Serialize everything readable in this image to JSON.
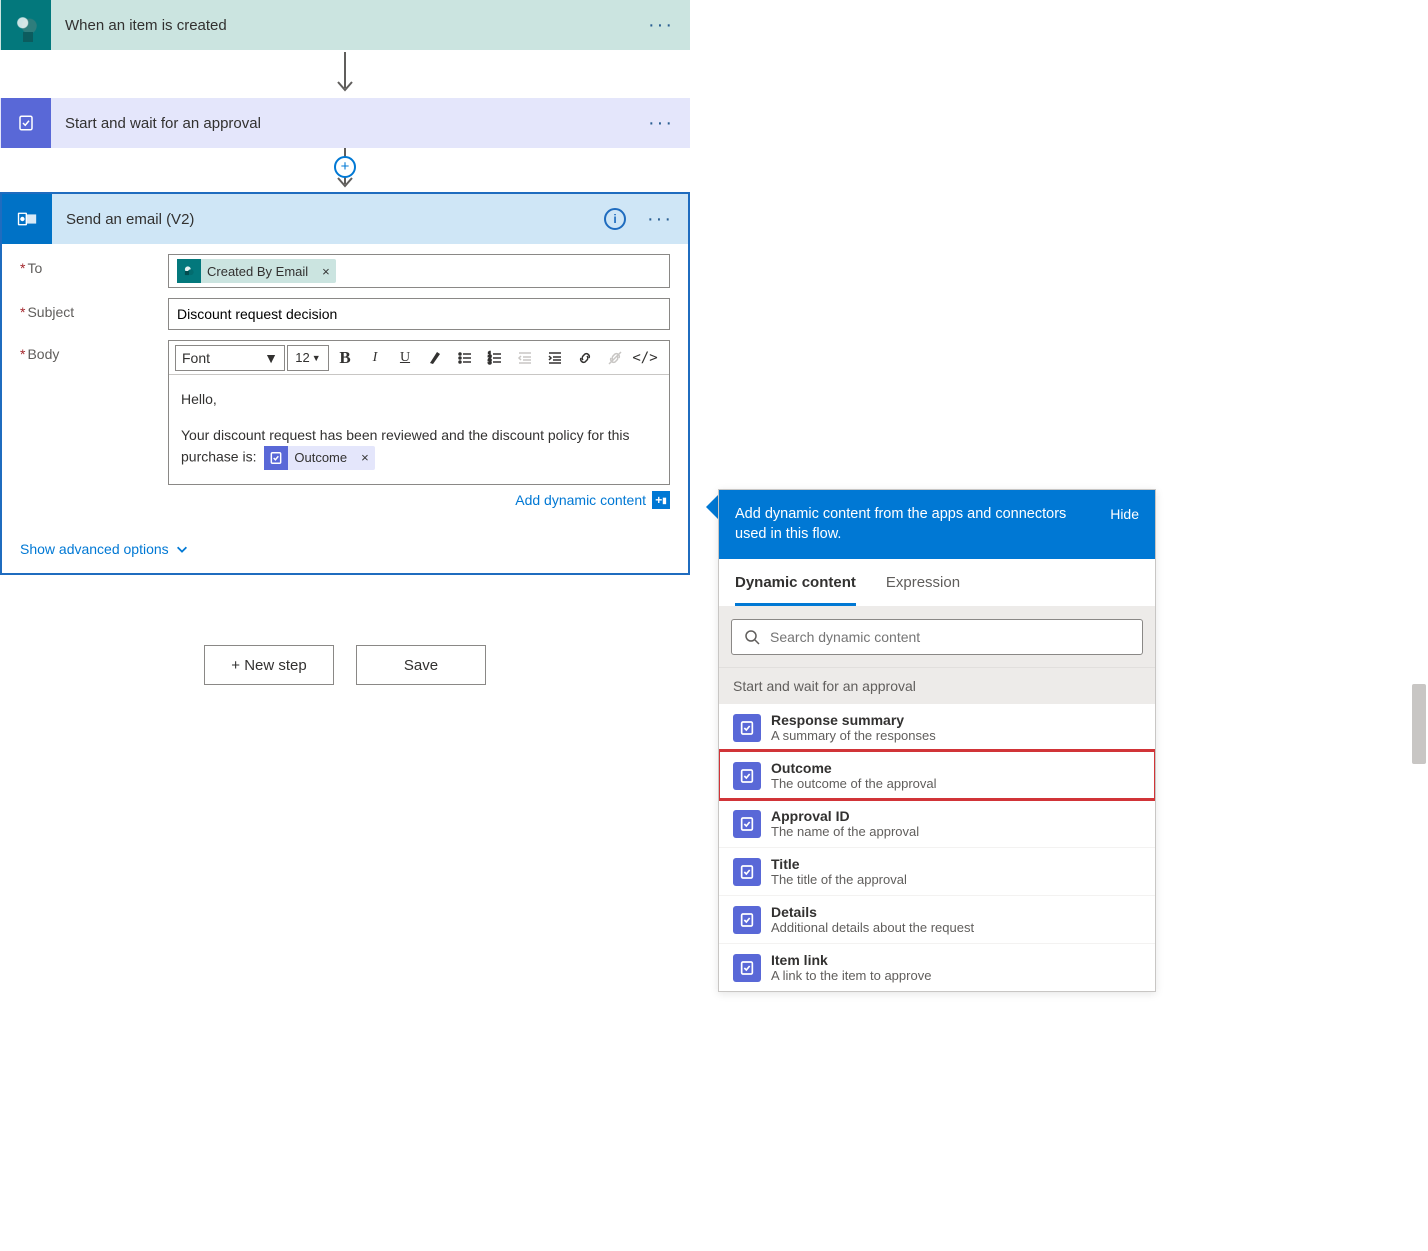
{
  "steps": {
    "trigger": {
      "title": "When an item is created"
    },
    "approval": {
      "title": "Start and wait for an approval"
    },
    "email": {
      "title": "Send an email (V2)",
      "fields": {
        "to_label": "To",
        "to_token": "Created By Email",
        "subject_label": "Subject",
        "subject_value": "Discount request decision",
        "body_label": "Body"
      },
      "rte": {
        "font_label": "Font",
        "size_label": "12"
      },
      "body_text": {
        "greeting": "Hello,",
        "line1a": "Your discount request has been reviewed and the discount policy for this purchase is:",
        "token": "Outcome"
      },
      "add_dynamic": "Add dynamic content",
      "advanced": "Show advanced options"
    }
  },
  "buttons": {
    "new_step": "+ New step",
    "save": "Save"
  },
  "dynamic": {
    "header_text": "Add dynamic content from the apps and connectors used in this flow.",
    "hide": "Hide",
    "tabs": {
      "dynamic": "Dynamic content",
      "expression": "Expression"
    },
    "search_placeholder": "Search dynamic content",
    "section": "Start and wait for an approval",
    "items": [
      {
        "title": "Response summary",
        "desc": "A summary of the responses"
      },
      {
        "title": "Outcome",
        "desc": "The outcome of the approval",
        "highlight": true
      },
      {
        "title": "Approval ID",
        "desc": "The name of the approval"
      },
      {
        "title": "Title",
        "desc": "The title of the approval"
      },
      {
        "title": "Details",
        "desc": "Additional details about the request"
      },
      {
        "title": "Item link",
        "desc": "A link to the item to approve"
      }
    ]
  }
}
